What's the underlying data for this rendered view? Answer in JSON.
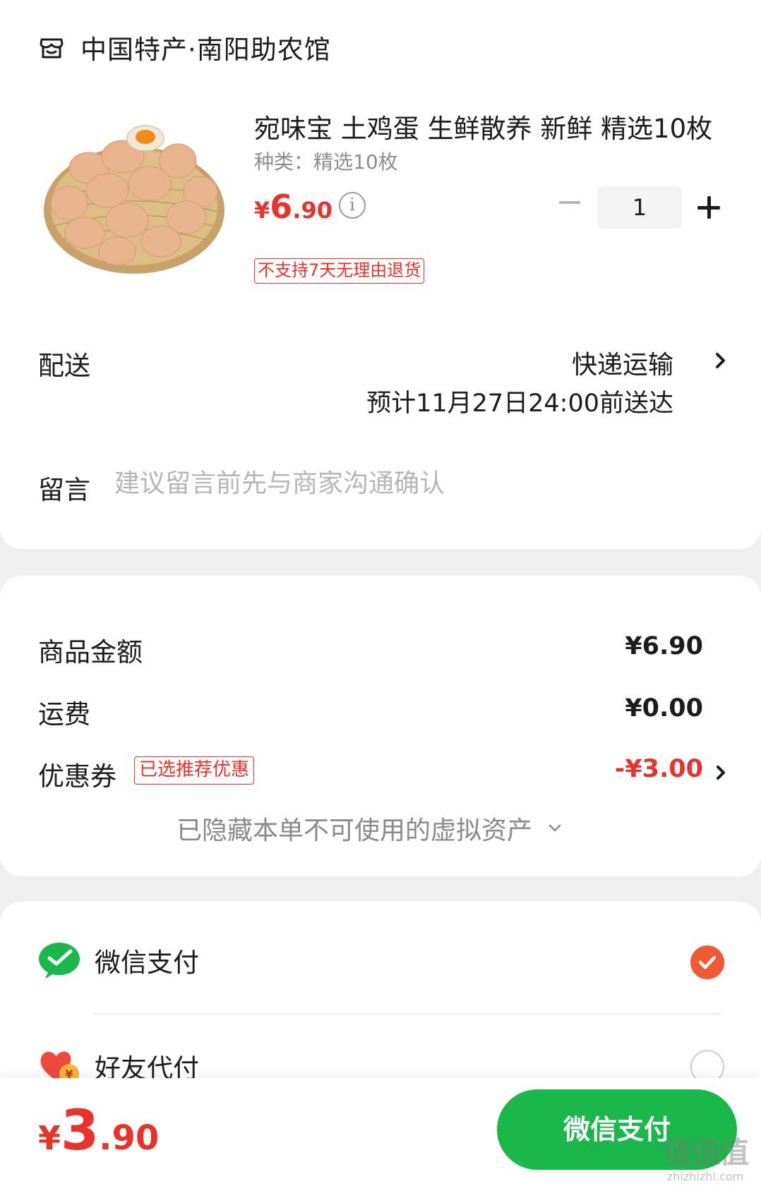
{
  "shop": {
    "name": "中国特产·南阳助农馆",
    "icon": "shop-icon"
  },
  "product": {
    "title": "宛味宝 土鸡蛋 生鲜散养 新鲜 精选10枚",
    "spec": "种类：精选10枚",
    "price": {
      "yen": "¥",
      "int": "6",
      "dec": ".90"
    },
    "quantity": "1",
    "return_tag": "不支持7天无理由退货",
    "image": "eggs-in-basket"
  },
  "delivery": {
    "label": "配送",
    "method": "快递运输",
    "estimate": "预计11月27日24:00前送达"
  },
  "message": {
    "label": "留言",
    "placeholder": "建议留言前先与商家沟通确认"
  },
  "amounts": {
    "goods_label": "商品金额",
    "goods_value": "¥6.90",
    "shipping_label": "运费",
    "shipping_value": "¥0.00",
    "coupon_label": "优惠券",
    "coupon_tag": "已选推荐优惠",
    "coupon_value": "-¥3.00",
    "hidden_assets": "已隐藏本单不可使用的虚拟资产"
  },
  "payment": {
    "options": [
      {
        "label": "微信支付",
        "icon": "wechat-pay-icon",
        "selected": true
      },
      {
        "label": "好友代付",
        "icon": "friend-pay-icon",
        "selected": false
      }
    ]
  },
  "bottom": {
    "total": {
      "yen": "¥",
      "int": "3",
      "dec": ".90"
    },
    "pay_button": "微信支付"
  },
  "watermark": {
    "main": "值值值",
    "sub": "zhizhizhi.com"
  },
  "colors": {
    "price_red": "#e8322a",
    "wechat_green": "#1ab84a",
    "checked_orange": "#f05a33",
    "background": "#efefef"
  }
}
